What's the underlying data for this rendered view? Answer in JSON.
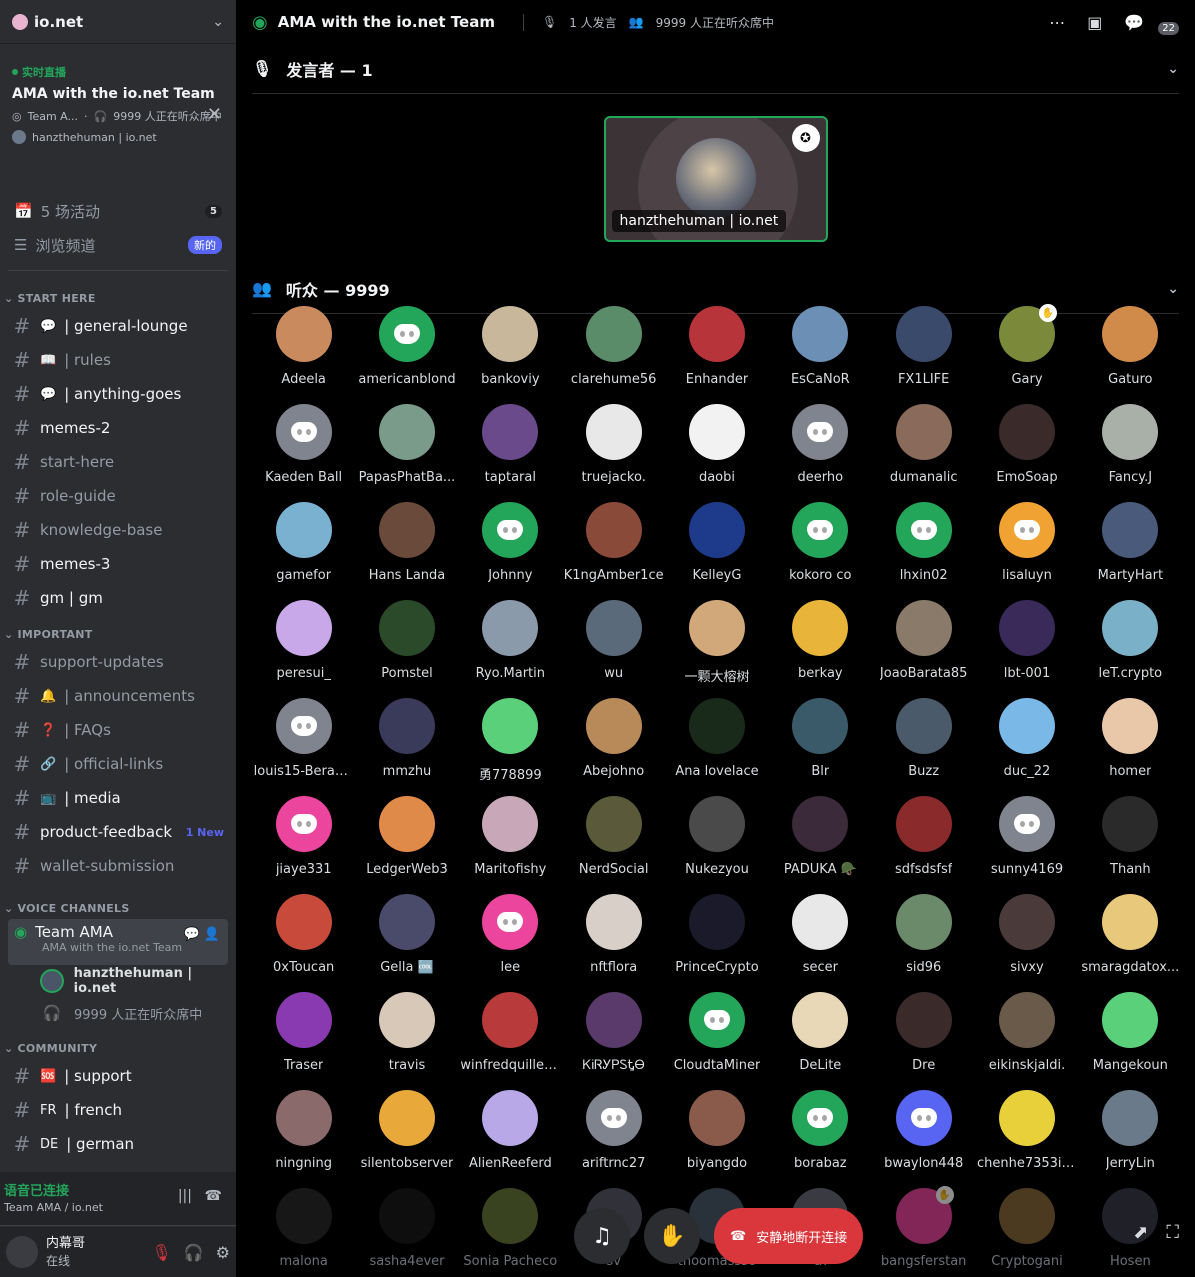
{
  "server": {
    "name": "io.net"
  },
  "live": {
    "tag": "实时直播",
    "title": "AMA with the io.net Team",
    "meta1": "Team A...",
    "meta2": "9999 人正在听众席中",
    "host": "hanzthehuman | io.net"
  },
  "nav": [
    {
      "icon": "calendar-icon",
      "label": "5 场活动",
      "badge": "5"
    },
    {
      "icon": "browse-icon",
      "label": "浏览频道",
      "new": "新的"
    }
  ],
  "categories": {
    "start": "START HERE",
    "start_channels": [
      {
        "label": "| general-lounge",
        "emoji": "💬",
        "bright": true
      },
      {
        "label": "| rules",
        "emoji": "📖",
        "bright": false
      },
      {
        "label": "| anything-goes",
        "emoji": "💬",
        "bright": true
      },
      {
        "label": "memes-2",
        "emoji": "",
        "bright": true
      },
      {
        "label": "start-here",
        "emoji": "",
        "bright": false
      },
      {
        "label": "role-guide",
        "emoji": "",
        "bright": false
      },
      {
        "label": "knowledge-base",
        "emoji": "",
        "bright": false
      },
      {
        "label": "memes-3",
        "emoji": "",
        "bright": true
      },
      {
        "label": "gm | gm",
        "emoji": "",
        "bright": true
      }
    ],
    "important": "IMPORTANT",
    "important_channels": [
      {
        "label": "support-updates",
        "emoji": "",
        "bright": false
      },
      {
        "label": "| announcements",
        "emoji": "🔔",
        "bright": false
      },
      {
        "label": "| FAQs",
        "emoji": "❓",
        "bright": false
      },
      {
        "label": "| official-links",
        "emoji": "🔗",
        "bright": false
      },
      {
        "label": "| media",
        "emoji": "📺",
        "bright": true
      },
      {
        "label": "product-feedback",
        "emoji": "",
        "bright": true,
        "newtag": "1 New"
      },
      {
        "label": "wallet-submission",
        "emoji": "",
        "bright": false
      }
    ],
    "voice": "VOICE CHANNELS",
    "community": "COMMUNITY",
    "community_channels": [
      {
        "label": "| support",
        "emoji": "🆘",
        "bright": true
      },
      {
        "label": "| french",
        "emoji": "FR",
        "bright": true
      },
      {
        "label": "| german",
        "emoji": "DE",
        "bright": true
      }
    ]
  },
  "voice_channel": {
    "title": "Team AMA",
    "sub": "AMA with the io.net Team",
    "user": "hanzthehuman | io.net",
    "listeners": "9999 人正在听众席中"
  },
  "voice_status": {
    "title": "语音已连接",
    "sub": "Team AMA / io.net"
  },
  "user": {
    "name": "内幕哥",
    "status": "在线"
  },
  "topbar": {
    "title": "AMA with the io.net Team",
    "speakers": "1 人发言",
    "listeners": "9999 人正在听众席中",
    "count": "22"
  },
  "speakers_section": {
    "label": "发言者 — 1",
    "speaker_name": "hanzthehuman | io.net"
  },
  "audience_section": {
    "label": "听众 — 9999"
  },
  "audience": [
    {
      "n": "Adeela",
      "c": "#c98a5e"
    },
    {
      "n": "americanblond",
      "c": "#23a55a",
      "d": 1
    },
    {
      "n": "bankoviy",
      "c": "#c9b79c"
    },
    {
      "n": "clarehume56",
      "c": "#5b8c6a"
    },
    {
      "n": "Enhander",
      "c": "#b8343b"
    },
    {
      "n": "EsCaNoR",
      "c": "#6b8fb5"
    },
    {
      "n": "FX1LIFE",
      "c": "#3a4a6b"
    },
    {
      "n": "Gary",
      "c": "#7a8a3a",
      "h": 1
    },
    {
      "n": "Gaturo",
      "c": "#d08a4a"
    },
    {
      "n": "Kaeden Ball",
      "c": "#80848e",
      "d": 1
    },
    {
      "n": "PapasPhatBa...",
      "c": "#7a9a8a"
    },
    {
      "n": "taptaral",
      "c": "#6a4a8a"
    },
    {
      "n": "truejacko.",
      "c": "#e8e8e8"
    },
    {
      "n": "daobi",
      "c": "#f2f2f2"
    },
    {
      "n": "deerho",
      "c": "#80848e",
      "d": 1
    },
    {
      "n": "dumanalic",
      "c": "#8a6a5a"
    },
    {
      "n": "EmoSoap",
      "c": "#3a2a2a"
    },
    {
      "n": "Fancy.J",
      "c": "#a8b0a8"
    },
    {
      "n": "gamefor",
      "c": "#7ab0d0"
    },
    {
      "n": "Hans Landa",
      "c": "#6a4a3a"
    },
    {
      "n": "Johnny",
      "c": "#23a55a",
      "d": 1
    },
    {
      "n": "K1ngAmber1ce",
      "c": "#8a4a3a"
    },
    {
      "n": "KelleyG",
      "c": "#1e3a8a"
    },
    {
      "n": "kokoro co",
      "c": "#23a55a",
      "d": 1
    },
    {
      "n": "lhxin02",
      "c": "#23a55a",
      "d": 1
    },
    {
      "n": "lisaluyn",
      "c": "#f0a232",
      "d": 1
    },
    {
      "n": "MartyHart",
      "c": "#4a5a7a"
    },
    {
      "n": "peresui_",
      "c": "#c8a8e8"
    },
    {
      "n": "Pomstel",
      "c": "#2a4a2a"
    },
    {
      "n": "Ryo.Martin",
      "c": "#8a9aaa"
    },
    {
      "n": "wu",
      "c": "#5a6a7a"
    },
    {
      "n": "一颗大榕树",
      "c": "#d0a87a"
    },
    {
      "n": "berkay",
      "c": "#e8b43a"
    },
    {
      "n": "JoaoBarata85",
      "c": "#8a7a6a"
    },
    {
      "n": "lbt-001",
      "c": "#3a2a5a"
    },
    {
      "n": "leT.crypto",
      "c": "#7ab0c8"
    },
    {
      "n": "louis15-Berac...",
      "c": "#80848e",
      "d": 1
    },
    {
      "n": "mmzhu",
      "c": "#3a3a5a"
    },
    {
      "n": "勇778899",
      "c": "#5ad07a"
    },
    {
      "n": "Abejohno",
      "c": "#b88a5a"
    },
    {
      "n": "Ana lovelace",
      "c": "#1a2a1a"
    },
    {
      "n": "Blr",
      "c": "#3a5a6a"
    },
    {
      "n": "Buzz",
      "c": "#4a5a6a"
    },
    {
      "n": "duc_22",
      "c": "#7ab8e8"
    },
    {
      "n": "homer",
      "c": "#e8c8a8"
    },
    {
      "n": "jiaye331",
      "c": "#eb459e",
      "d": 1
    },
    {
      "n": "LedgerWeb3",
      "c": "#e08a4a"
    },
    {
      "n": "Maritofishy",
      "c": "#c8a8b8"
    },
    {
      "n": "NerdSocial",
      "c": "#5a5a3a"
    },
    {
      "n": "Nukezyou",
      "c": "#4a4a4a"
    },
    {
      "n": "PADUKA 🪖",
      "c": "#3a2a3a"
    },
    {
      "n": "sdfsdsfsf",
      "c": "#8a2a2a"
    },
    {
      "n": "sunny4169",
      "c": "#80848e",
      "d": 1
    },
    {
      "n": "Thanh",
      "c": "#2a2a2a"
    },
    {
      "n": "0xToucan",
      "c": "#c84a3a"
    },
    {
      "n": "Gella 🆒",
      "c": "#4a4a6a"
    },
    {
      "n": "lee",
      "c": "#eb459e",
      "d": 1
    },
    {
      "n": "nftflora",
      "c": "#d8d0c8"
    },
    {
      "n": "PrinceCrypto",
      "c": "#1a1a2a"
    },
    {
      "n": "secer",
      "c": "#e8e8e8"
    },
    {
      "n": "sid96",
      "c": "#6a8a6a"
    },
    {
      "n": "sivxy",
      "c": "#4a3a3a"
    },
    {
      "n": "smaragdatox...",
      "c": "#e8c87a"
    },
    {
      "n": "Traser",
      "c": "#8a3ab0"
    },
    {
      "n": "travis",
      "c": "#d8c8b8"
    },
    {
      "n": "winfredquiller...",
      "c": "#b83a3a"
    },
    {
      "n": "ᏦᎥᏒᎩᏢᏚᎿᎾ",
      "c": "#5a3a6a"
    },
    {
      "n": "CloudtaMiner",
      "c": "#23a55a",
      "d": 1
    },
    {
      "n": "DeLite",
      "c": "#e8d8b8"
    },
    {
      "n": "Dre",
      "c": "#3a2a2a"
    },
    {
      "n": "eikinskjaldi.",
      "c": "#6a5a4a"
    },
    {
      "n": "Mangekoun",
      "c": "#5ad07a"
    },
    {
      "n": "ningning",
      "c": "#8a6a6a"
    },
    {
      "n": "silentobserver",
      "c": "#e8a83a"
    },
    {
      "n": "AlienReeferd",
      "c": "#b8a8e8"
    },
    {
      "n": "ariftrnc27",
      "c": "#80848e",
      "d": 1
    },
    {
      "n": "biyangdo",
      "c": "#8a5a4a"
    },
    {
      "n": "borabaz",
      "c": "#23a55a",
      "d": 1
    },
    {
      "n": "bwaylon448",
      "c": "#5865f2",
      "d": 1
    },
    {
      "n": "chenhe7353io...",
      "c": "#e8d03a"
    },
    {
      "n": "JerryLin",
      "c": "#6a7a8a"
    },
    {
      "n": "malona",
      "c": "#2a2a2a",
      "x": 1
    },
    {
      "n": "sasha4ever",
      "c": "#1a1a1a",
      "x": 1
    },
    {
      "n": "Sonia Pacheco",
      "c": "#6a7a3a",
      "x": 1
    },
    {
      "n": "sv",
      "c": "#5a5a6a",
      "x": 1
    },
    {
      "n": "thoomasss6",
      "c": "#4a5a6a",
      "x": 1
    },
    {
      "n": "tx",
      "c": "#6a6a7a",
      "x": 1
    },
    {
      "n": "bangsferstan",
      "c": "#eb459e",
      "x": 1,
      "h": 1
    },
    {
      "n": "Cryptogani",
      "c": "#8a6a3a",
      "x": 1
    },
    {
      "n": "Hosen",
      "c": "#3a3a4a",
      "x": 1
    }
  ],
  "controls": {
    "leave_label": "安静地断开连接"
  }
}
